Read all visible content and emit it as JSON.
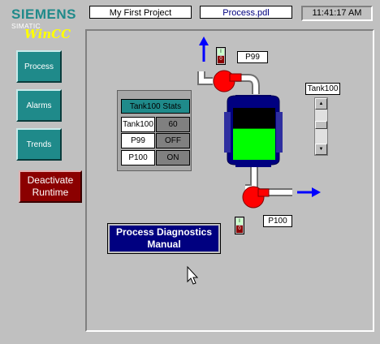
{
  "logo": {
    "brand": "SIEMENS",
    "product_line": "SIMATIC",
    "product": "WinCC"
  },
  "header": {
    "project": "My First Project",
    "picture": "Process.pdl",
    "time": "11:41:17 AM"
  },
  "nav": [
    {
      "label": "Process"
    },
    {
      "label": "Alarms"
    },
    {
      "label": "Trends"
    }
  ],
  "deactivate": {
    "line1": "Deactivate",
    "line2": "Runtime"
  },
  "stats": {
    "title": "Tank100 Stats",
    "rows": [
      {
        "name": "Tank100",
        "value": "60"
      },
      {
        "name": "P99",
        "value": "OFF"
      },
      {
        "name": "P100",
        "value": "ON"
      }
    ]
  },
  "tags": {
    "pump_top": "P99",
    "pump_bottom": "P100",
    "tank_slider": "Tank100"
  },
  "toggle": {
    "on": "I",
    "off": "0"
  },
  "tank_level_percent": 60,
  "diagnostics": {
    "line1": "Process Diagnostics",
    "line2": "Manual"
  },
  "colors": {
    "teal": "#1f8a8a",
    "dark_red": "#8b0000",
    "navy": "#000080",
    "tank_fill": "#00ff00",
    "pump_red": "#ff0000",
    "flow_arrow": "#0000ff"
  }
}
